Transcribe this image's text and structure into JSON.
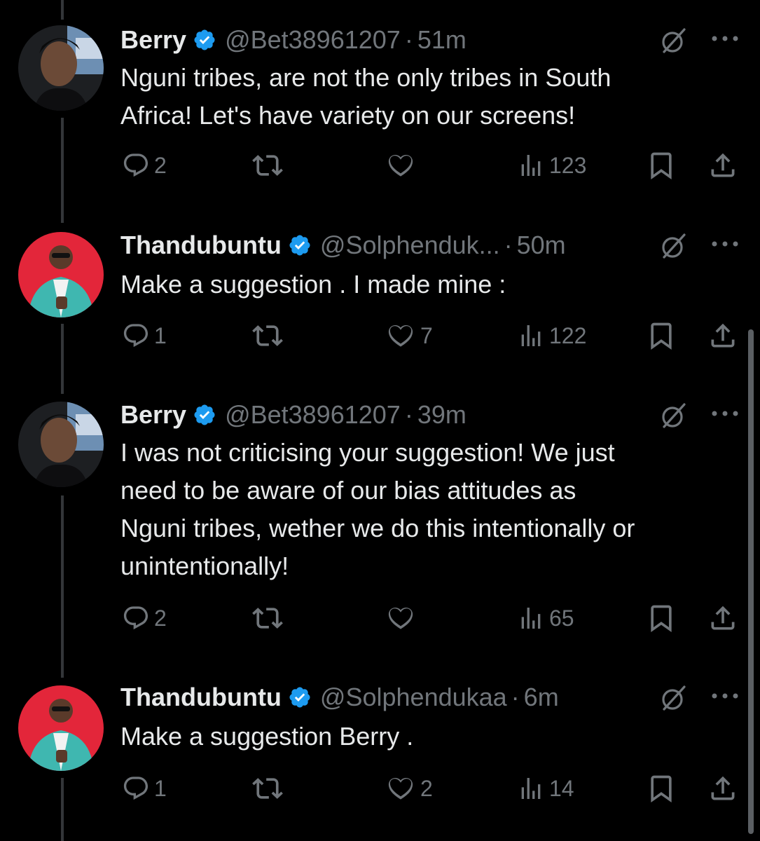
{
  "colors": {
    "background": "#000000",
    "text": "#e7e9ea",
    "muted": "#71767b",
    "verified": "#1d9bf0",
    "thread_line": "#333639"
  },
  "icons": {
    "verified": "verified-badge-icon",
    "grok": "grok-icon",
    "more": "more-dots-icon",
    "reply": "reply-icon",
    "retweet": "retweet-icon",
    "like": "heart-icon",
    "views": "views-chart-icon",
    "bookmark": "bookmark-icon",
    "share": "share-icon"
  },
  "tweets": [
    {
      "name": "Berry",
      "handle": "@Bet38961207",
      "time": "51m",
      "lines": [
        "Nguni tribes, are not the only tribes in South",
        "Africa! Let's have variety on our screens!"
      ],
      "replies": "2",
      "retweets": "",
      "likes": "",
      "views": "123"
    },
    {
      "name": "Thandubuntu",
      "handle": "@Solphenduk...",
      "time": "50m",
      "lines": [
        "Make a suggestion . I made mine :"
      ],
      "replies": "1",
      "retweets": "",
      "likes": "7",
      "views": "122"
    },
    {
      "name": "Berry",
      "handle": "@Bet38961207",
      "time": "39m",
      "lines": [
        "I was not criticising your suggestion! We just",
        "need to be aware of our bias attitudes as",
        "Nguni tribes, wether we do this intentionally or",
        "unintentionally!"
      ],
      "replies": "2",
      "retweets": "",
      "likes": "",
      "views": "65"
    },
    {
      "name": "Thandubuntu",
      "handle": "@Solphendukaa",
      "time": "6m",
      "lines": [
        "Make a suggestion Berry ."
      ],
      "replies": "1",
      "retweets": "",
      "likes": "2",
      "views": "14"
    }
  ]
}
